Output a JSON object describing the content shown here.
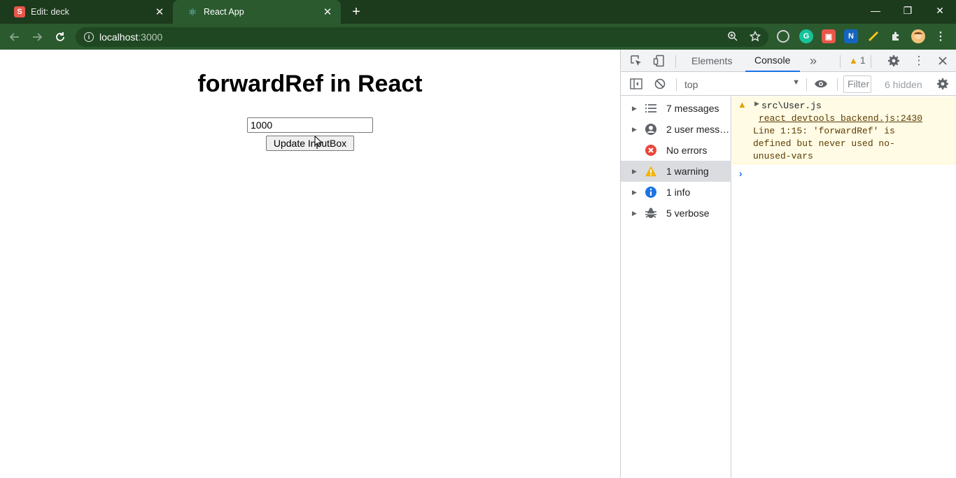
{
  "browser": {
    "tabs": [
      {
        "favicon": "S",
        "title": "Edit: deck",
        "close": "✕"
      },
      {
        "favicon": "⚛",
        "title": "React App",
        "close": "✕"
      }
    ],
    "new_tab": "+",
    "window_controls": {
      "minimize": "—",
      "restore": "❐",
      "close": "✕"
    },
    "address": {
      "host": "localhost",
      "port": ":3000"
    }
  },
  "page": {
    "heading": "forwardRef in React",
    "input_value": "1000",
    "button_label": "Update InputBox"
  },
  "devtools": {
    "tabs": {
      "elements": "Elements",
      "console": "Console",
      "more": "»"
    },
    "warning_count": "1",
    "context": "top",
    "filter_placeholder": "Filter",
    "hidden_count": "6 hidden",
    "sidebar": [
      {
        "label": "7 messages",
        "icon": "list-icon"
      },
      {
        "label": "2 user messages",
        "icon": "user-icon"
      },
      {
        "label": "No errors",
        "icon": "error-icon"
      },
      {
        "label": "1 warning",
        "icon": "warning-icon"
      },
      {
        "label": "1 info",
        "icon": "info-icon"
      },
      {
        "label": "5 verbose",
        "icon": "bug-icon"
      }
    ],
    "message": {
      "source": "src\\User.js",
      "link": "react_devtools_backend.js:2430",
      "text_lines": [
        "Line 1:15:  'forwardRef' is",
        "defined but never used  no-",
        "unused-vars"
      ]
    },
    "prompt": "›"
  },
  "colors": {
    "chrome_dark": "#1c3a1c",
    "chrome_toolbar": "#2a5a2e",
    "accent_blue": "#1a73e8",
    "warning_amber": "#e6a100",
    "warning_bg": "#fffbe5"
  }
}
